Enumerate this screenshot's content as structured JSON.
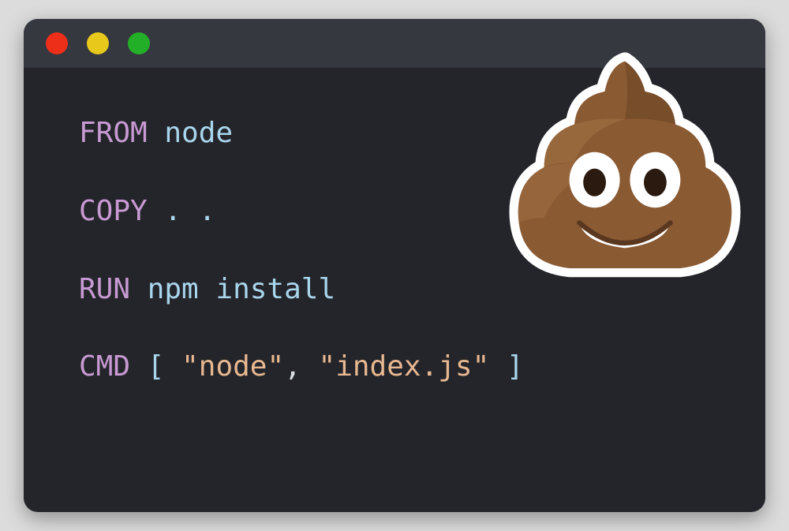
{
  "code": {
    "line1": {
      "keyword": "FROM",
      "arg": " node"
    },
    "line2": {
      "keyword": "COPY",
      "arg": " . ."
    },
    "line3": {
      "keyword": "RUN",
      "arg": " npm install"
    },
    "line4": {
      "keyword": "CMD",
      "sp1": " ",
      "br_open": "[",
      "sp2": " ",
      "str1": "\"node\"",
      "comma": ",",
      "sp3": " ",
      "str2": "\"index.js\"",
      "sp4": " ",
      "br_close": "]"
    }
  },
  "emoji": {
    "name": "pile-of-poo"
  }
}
